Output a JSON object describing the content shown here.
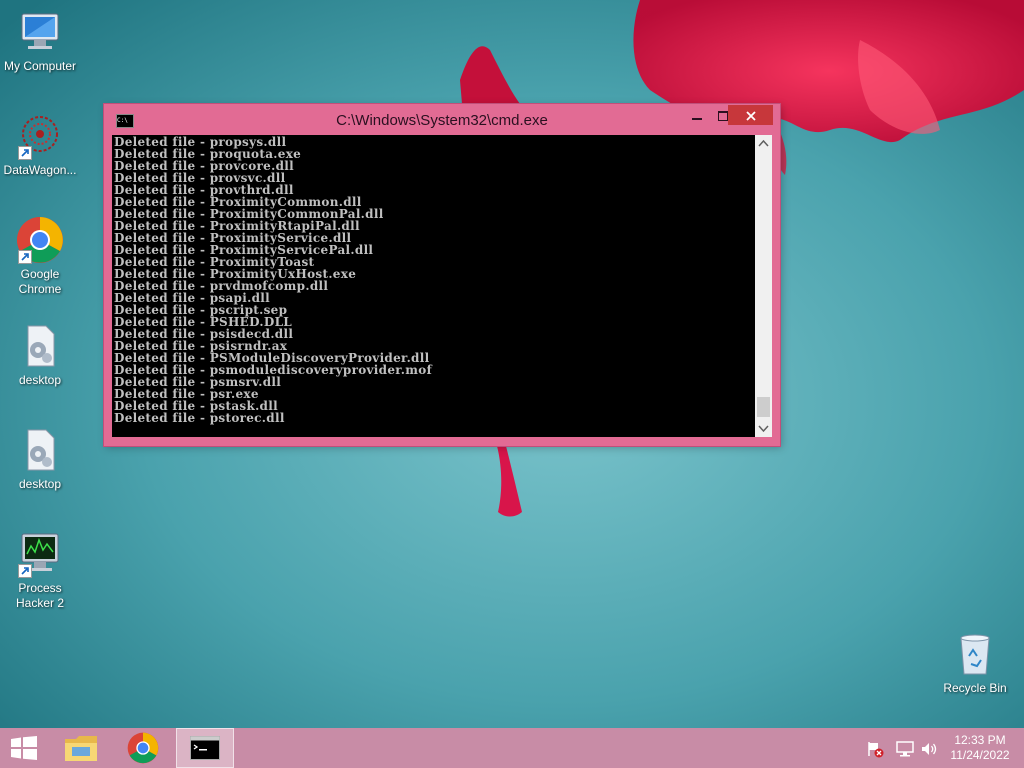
{
  "desktop": {
    "icons": [
      {
        "label": "My Computer",
        "icon": "computer-icon"
      },
      {
        "label": "DataWagon...",
        "icon": "datawagon-icon"
      },
      {
        "label": "Google Chrome",
        "icon": "chrome-icon"
      },
      {
        "label": "desktop",
        "icon": "config-file-icon"
      },
      {
        "label": "desktop",
        "icon": "config-file-icon"
      },
      {
        "label": "Process Hacker 2",
        "icon": "process-hacker-icon"
      },
      {
        "label": "Recycle Bin",
        "icon": "recycle-bin-icon"
      }
    ]
  },
  "cmd_window": {
    "title": "C:\\Windows\\System32\\cmd.exe",
    "app_icon_text": "C:\\",
    "controls": {
      "minimize": "minimize-icon",
      "maximize": "maximize-icon",
      "close": "close-icon"
    },
    "console_lines": [
      "Deleted file - propsys.dll",
      "Deleted file - proquota.exe",
      "Deleted file - provcore.dll",
      "Deleted file - provsvc.dll",
      "Deleted file - provthrd.dll",
      "Deleted file - ProximityCommon.dll",
      "Deleted file - ProximityCommonPal.dll",
      "Deleted file - ProximityRtapiPal.dll",
      "Deleted file - ProximityService.dll",
      "Deleted file - ProximityServicePal.dll",
      "Deleted file - ProximityToast",
      "Deleted file - ProximityUxHost.exe",
      "Deleted file - prvdmofcomp.dll",
      "Deleted file - psapi.dll",
      "Deleted file - pscript.sep",
      "Deleted file - PSHED.DLL",
      "Deleted file - psisdecd.dll",
      "Deleted file - psisrndr.ax",
      "Deleted file - PSModuleDiscoveryProvider.dll",
      "Deleted file - psmodulediscoveryprovider.mof",
      "Deleted file - psmsrv.dll",
      "Deleted file - psr.exe",
      "Deleted file - pstask.dll",
      "Deleted file - pstorec.dll"
    ]
  },
  "taskbar": {
    "start": "windows-logo-icon",
    "pinned": [
      {
        "name": "file-explorer",
        "icon": "folder-icon"
      },
      {
        "name": "chrome",
        "icon": "chrome-icon"
      },
      {
        "name": "cmd",
        "icon": "cmd-icon",
        "active": true
      }
    ],
    "tray": {
      "icons": [
        "action-center-flag-icon",
        "network-icon",
        "volume-icon"
      ],
      "time": "12:33 PM",
      "date": "11/24/2022"
    }
  },
  "colors": {
    "accent": "#e26b94",
    "close_button": "#c7373b",
    "console_bg": "#000000",
    "console_text": "#c0c0c0",
    "wallpaper_teal": "#3d9aa6",
    "flower_red": "#e0103c"
  }
}
